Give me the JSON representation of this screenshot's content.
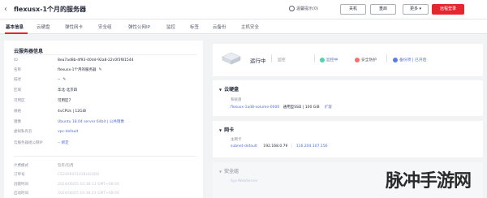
{
  "header": {
    "back_icon": "chevron-left",
    "title": "flexusx-1个月的服务器",
    "tip": "温馨提示(0)",
    "buttons": {
      "shutdown": "关机",
      "restart": "重启",
      "more": "更多",
      "remote_login": "远程登录"
    }
  },
  "tabs": [
    "基本信息",
    "云硬盘",
    "弹性网卡",
    "安全组",
    "弹性公网IP",
    "监控",
    "标签",
    "云备份",
    "主机安全"
  ],
  "info": {
    "section_title": "云服务器信息",
    "rows": [
      {
        "label": "ID",
        "value": "8ea7ad8b-4f93-40dd-92a8-22c0f3f81544",
        "style": "plain"
      },
      {
        "label": "名称",
        "value": "flexusx-1个月的服务器",
        "style": "plain",
        "editable": true
      },
      {
        "label": "描述",
        "value": "--",
        "style": "plain",
        "editable": true
      },
      {
        "label": "区域",
        "value": "华北-北京四",
        "style": "plain"
      },
      {
        "label": "可用区",
        "value": "可用区7",
        "style": "plain"
      },
      {
        "label": "规格",
        "value": "4vCPUs | 12GiB",
        "style": "plain"
      },
      {
        "label": "镜像",
        "value": "Ubuntu 18.04 server 64bit | 公共镜像",
        "style": "link"
      },
      {
        "label": "虚拟私有云",
        "value": "vpc-default",
        "style": "link"
      },
      {
        "label": "云服务器组公网IP",
        "value": "-- 绑定",
        "style": "link"
      }
    ],
    "rows2": [
      {
        "label": "计费模式",
        "value": "包年/包月",
        "style": "dim"
      },
      {
        "label": "订单号",
        "value": "CS2406051038UGQDS",
        "style": "faded"
      },
      {
        "label": "创建时间",
        "value": "2024/06/05 10:38:13 GMT+08:00",
        "style": "faded"
      },
      {
        "label": "启动时间",
        "value": "2024/06/05 10:38:23 GMT+08:00",
        "style": "faded"
      }
    ]
  },
  "status": {
    "state": "运行中",
    "monitor_label": "监控",
    "items": [
      {
        "text": "监控中",
        "icon": "check-circle",
        "color": "#50d4ab"
      },
      {
        "text": "安全防护",
        "icon": "shield",
        "color": "#f66f6a"
      },
      {
        "text": "备份项 | 已开启",
        "icon": "backup",
        "color": "#5e7ce0"
      }
    ]
  },
  "disk_card": {
    "title": "云硬盘",
    "sub": "系统盘",
    "line_link": "flexusx-1ad8-volume-0000",
    "line_text": "通用型SSD | 100 GiB",
    "line_action": "扩容"
  },
  "nic_card": {
    "title": "网卡",
    "sub": "主网卡",
    "line_link": "subnet-default",
    "line_text": "192.168.0.79",
    "line_link2": "116.204.107.156"
  },
  "sec_card": {
    "title": "安全组",
    "line": "Sys-WebServer"
  },
  "watermark": "脉冲手游网",
  "colors": {
    "accent": "#e5262f",
    "link": "#526ecc",
    "page_bg": "#f2f3f5"
  }
}
